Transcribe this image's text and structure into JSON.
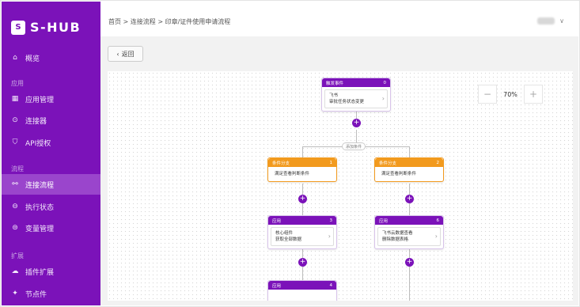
{
  "brand": {
    "logo_mark": "S",
    "name": "S-HUB"
  },
  "sidebar": {
    "overview": "概览",
    "sections": [
      {
        "title": "应用",
        "items": [
          "应用管理",
          "连接器",
          "API授权"
        ]
      },
      {
        "title": "流程",
        "items": [
          "连接流程",
          "执行状态",
          "变量管理"
        ]
      },
      {
        "title": "扩展",
        "items": [
          "插件扩展",
          "节点件"
        ]
      }
    ]
  },
  "header": {
    "breadcrumb": "首页 > 连接流程 > 印章/证件使用申请流程",
    "user_chevron": "∨"
  },
  "back_button": {
    "label": "返回"
  },
  "zoom": {
    "minus": "−",
    "value": "70%",
    "plus": "+"
  },
  "flow": {
    "trigger": {
      "title": "触发事件",
      "num": "0",
      "line1": "飞书",
      "line2": "审批任务状态变更"
    },
    "branch_label": "添加条件",
    "cond1": {
      "title": "条件分支",
      "num": "1",
      "text": "满足查看判断条件"
    },
    "cond2": {
      "title": "条件分支",
      "num": "2",
      "text": "满足查看判断条件"
    },
    "app3": {
      "title": "应用",
      "num": "3",
      "line1": "核心组件",
      "line2": "获取全部数据"
    },
    "app6": {
      "title": "应用",
      "num": "6",
      "line1": "飞书云数据查看",
      "line2": "删除数据表格"
    },
    "app4": {
      "title": "应用",
      "num": "4"
    }
  },
  "colors": {
    "sidebar": "#7b12b9",
    "active": "#9a45cc",
    "branch": "#f29a1e"
  }
}
